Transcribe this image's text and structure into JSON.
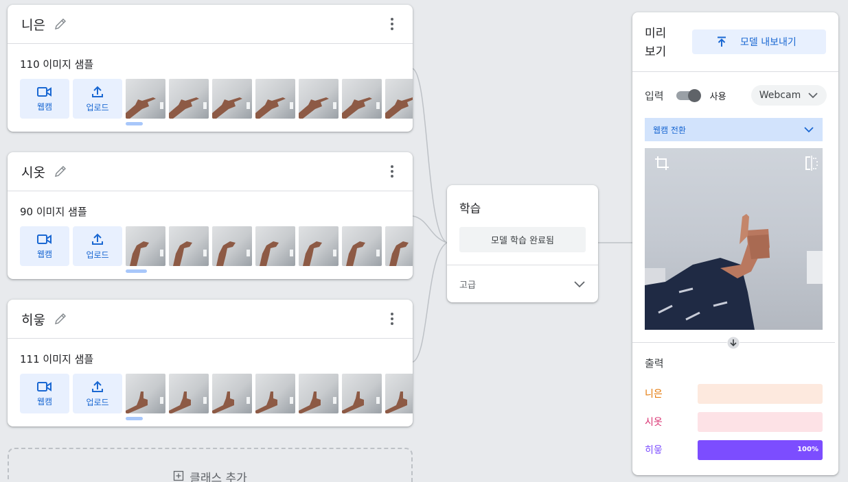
{
  "classes": [
    {
      "name": "니은",
      "sample_count": "110 이미지 샘플",
      "webcam_label": "웹캠",
      "upload_label": "업로드"
    },
    {
      "name": "시옷",
      "sample_count": "90 이미지 샘플",
      "webcam_label": "웹캠",
      "upload_label": "업로드"
    },
    {
      "name": "히읗",
      "sample_count": "111 이미지 샘플",
      "webcam_label": "웹캠",
      "upload_label": "업로드"
    }
  ],
  "add_class": {
    "label": "클래스 추가",
    "icon": "add-box-icon"
  },
  "training": {
    "title": "학습",
    "button_label": "모델 학습 완료됨",
    "advanced_label": "고급"
  },
  "preview": {
    "title": "미리 보기",
    "export_label": "모델 내보내기",
    "input_label": "입력",
    "toggle_label": "사용",
    "toggle_on": true,
    "source": "Webcam",
    "switch_webcam": "웹캠 전환",
    "output_title": "출력",
    "outputs": [
      {
        "label": "니은",
        "percent": 0,
        "label_color": "#e37400",
        "bar_color": "#fde9de",
        "fill_color": "#f28b54"
      },
      {
        "label": "시옷",
        "percent": 0,
        "label_color": "#d93070",
        "bar_color": "#fde2e6",
        "fill_color": "#e04e7e"
      },
      {
        "label": "히읗",
        "percent": 100,
        "percent_text": "100%",
        "label_color": "#7c4dff",
        "bar_color": "#7c4dff",
        "fill_color": "#7c4dff"
      }
    ]
  },
  "colors": {
    "accent": "#1967d2",
    "accent_light": "#e8f0fe",
    "background": "#e8eaed"
  }
}
